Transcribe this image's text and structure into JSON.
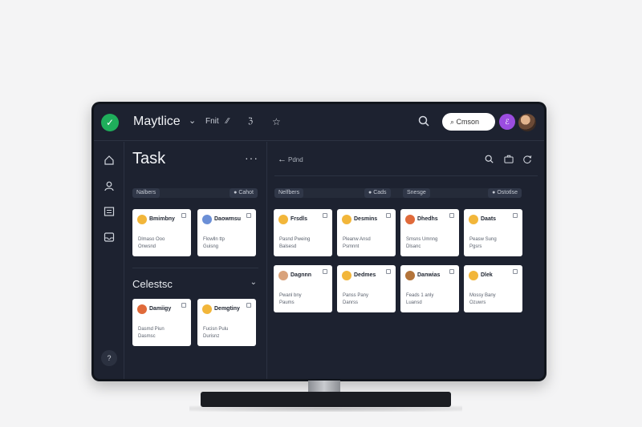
{
  "app": {
    "title": "Maytlice",
    "chevron": "⌄",
    "menu": [
      "Fnit",
      "⁄⁄",
      "ℨ",
      "☆"
    ],
    "search_placeholder": "Cmson",
    "user_initial": "ℰ"
  },
  "icons": {
    "logo": "check-logo-icon",
    "search": "search-icon",
    "home": "home-icon",
    "user": "user-icon",
    "list": "list-icon",
    "inbox": "inbox-icon",
    "more": "more-dots-icon",
    "back": "back-arrow-icon",
    "briefcase": "briefcase-icon",
    "refresh": "refresh-icon",
    "help": "help-icon"
  },
  "sidebar": {
    "bottom_label": "?"
  },
  "left_panel": {
    "title": "Task",
    "more": "···",
    "chips": [
      "Nalbers",
      "Cahot"
    ],
    "chip_icon": "●",
    "cards": [
      {
        "name": "Bmimbny",
        "line1": "Dlmaso Ooo",
        "line2": "Onwsnd",
        "avatar": "#f2b63a"
      },
      {
        "name": "Daowmsu",
        "line1": "Flowlln ttp",
        "line2": "Guisng",
        "avatar": "#6b8fd6"
      }
    ],
    "section_title": "Celestsc",
    "section_chevron": "⌄",
    "section_cards": [
      {
        "name": "Damiigy",
        "line1": "Dasmd Piun",
        "line2": "Dasmsc",
        "avatar": "#e06a3a"
      },
      {
        "name": "Demgtiny",
        "line1": "Fucisn Pulu",
        "line2": "Durisnz",
        "avatar": "#f2b63a"
      }
    ]
  },
  "right_panel": {
    "back_arrow": "←",
    "back_label": "Pdnd",
    "chips": [
      "Nelfbers",
      "Cads",
      "Snesge",
      "Ostotlse"
    ],
    "cards_row1": [
      {
        "name": "Frsdls",
        "line1": "Pasnd Pweing",
        "line2": "Balsesd",
        "avatar": "#f2b63a"
      },
      {
        "name": "Desmins",
        "line1": "Pleanw Ansd",
        "line2": "Psmnnt",
        "avatar": "#f2b63a"
      },
      {
        "name": "Dhedhs",
        "line1": "Smsns Umnng",
        "line2": "Dlsanc",
        "avatar": "#e06a3a"
      },
      {
        "name": "Daats",
        "line1": "Peasw Sung",
        "line2": "Pgsrs",
        "avatar": "#f2b63a"
      }
    ],
    "cards_row2": [
      {
        "name": "Dagnnn",
        "line1": "Pwanl bny",
        "line2": "Paums",
        "avatar": "#d9a27a"
      },
      {
        "name": "Dedmes",
        "line1": "Panss Pany",
        "line2": "Danrss",
        "avatar": "#f2b63a"
      },
      {
        "name": "Danwias",
        "line1": "Feads 1 anly",
        "line2": "Luansd",
        "avatar": "#b3743a"
      },
      {
        "name": "Dlek",
        "line1": "Mossy Bany",
        "line2": "Ozuwrs",
        "avatar": "#f2b63a"
      }
    ]
  },
  "colors": {
    "screen_bg": "#1d2230",
    "accent_green": "#1fae5b",
    "accent_purple": "#9b4de0",
    "card_bg": "#ffffff"
  }
}
